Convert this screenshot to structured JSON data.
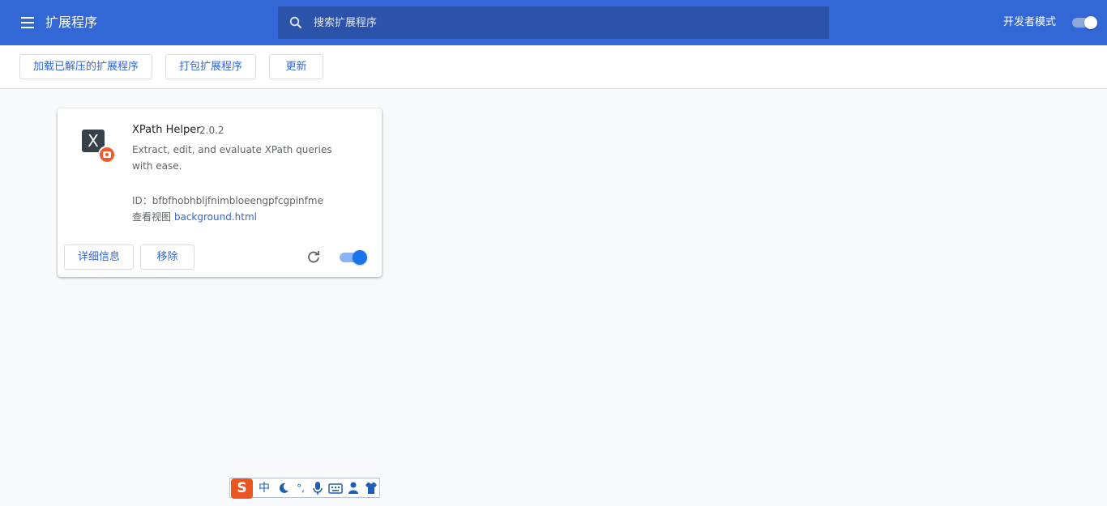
{
  "header": {
    "title": "扩展程序",
    "search_placeholder": "搜索扩展程序",
    "dev_mode_label": "开发者模式",
    "dev_mode_on": true
  },
  "toolbar": {
    "load_unpacked": "加载已解压的扩展程序",
    "pack_extension": "打包扩展程序",
    "update": "更新"
  },
  "extension": {
    "name": "XPath Helper",
    "version": "2.0.2",
    "description": "Extract, edit, and evaluate XPath queries with ease.",
    "id_line": "ID：bfbfhobhbljfnimbloeengpfcgpinfme",
    "views_label": "查看视图",
    "views_link": "background.html",
    "details_button": "详细信息",
    "remove_button": "移除",
    "enabled": true,
    "icon_glyph": "X"
  },
  "ime_bar": {
    "logo": "S",
    "mode": "中",
    "punct": "°,"
  },
  "colors": {
    "header": "#3367d6",
    "search_bg": "#2a53a9",
    "accent": "#3367d6",
    "toggle_on": "#1a73e8",
    "badge": "#f05a28"
  },
  "icons": [
    "menu-icon",
    "search-icon",
    "reload-icon",
    "xpath-helper-icon",
    "moon-icon",
    "microphone-icon",
    "keyboard-icon",
    "user-icon",
    "shirt-icon"
  ]
}
